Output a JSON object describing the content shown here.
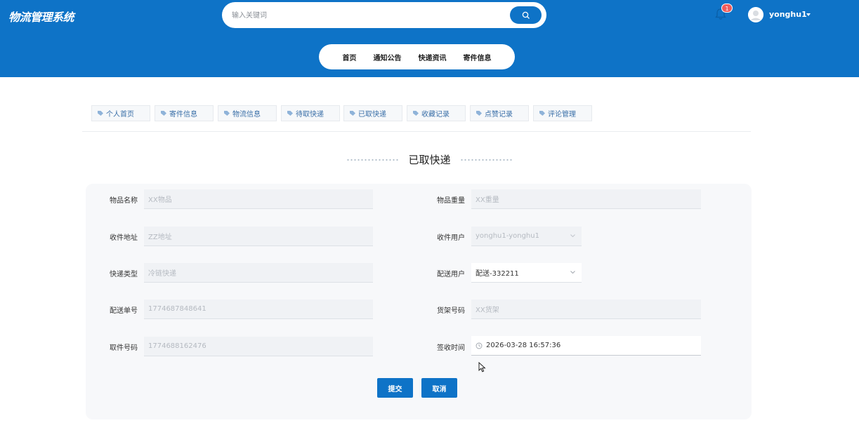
{
  "app": {
    "title": "物流管理系统"
  },
  "search": {
    "placeholder": "输入关键词"
  },
  "header": {
    "notification_count": "1",
    "username": "yonghu1"
  },
  "nav": {
    "items": [
      "首页",
      "通知公告",
      "快递资讯",
      "寄件信息"
    ]
  },
  "tabs": {
    "items": [
      "个人首页",
      "寄件信息",
      "物流信息",
      "待取快递",
      "已取快递",
      "收藏记录",
      "点赞记录",
      "评论管理"
    ]
  },
  "section": {
    "title": "已取快递"
  },
  "form": {
    "item_name": {
      "label": "物品名称",
      "placeholder": "XX物品"
    },
    "item_weight": {
      "label": "物品重量",
      "placeholder": "XX重量"
    },
    "recv_address": {
      "label": "收件地址",
      "placeholder": "ZZ地址"
    },
    "recv_user": {
      "label": "收件用户",
      "value": "yonghu1-yonghu1"
    },
    "express_type": {
      "label": "快递类型",
      "value": "冷链快递"
    },
    "delivery_user": {
      "label": "配送用户",
      "value": "配送-332211"
    },
    "delivery_no": {
      "label": "配送单号",
      "value": "1774687848641"
    },
    "shelf_no": {
      "label": "货架号码",
      "placeholder": "XX货架"
    },
    "pickup_no": {
      "label": "取件号码",
      "value": "1774688162476"
    },
    "sign_time": {
      "label": "签收时间",
      "value": "2026-03-28 16:57:36"
    }
  },
  "buttons": {
    "submit": "提交",
    "cancel": "取消"
  },
  "colors": {
    "primary": "#0e73c7",
    "badge": "#ef5b5b",
    "panel": "#f7f8fa"
  }
}
